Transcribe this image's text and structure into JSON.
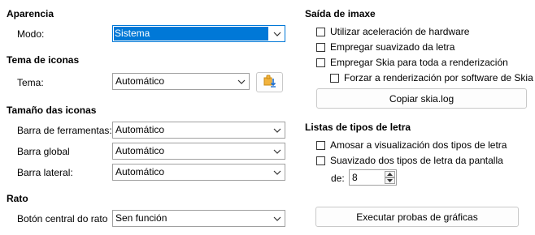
{
  "appearance": {
    "title": "Aparencia",
    "mode_label": "Modo:",
    "mode_value": "Sistema"
  },
  "icon_theme": {
    "title": "Tema de iconas",
    "theme_label": "Tema:",
    "theme_value": "Automático"
  },
  "icon_size": {
    "title": "Tamaño das iconas",
    "toolbar_label": "Barra de ferramentas:",
    "toolbar_value": "Automático",
    "global_label": "Barra global",
    "global_value": "Automático",
    "sidebar_label": "Barra lateral:",
    "sidebar_value": "Automático"
  },
  "mouse": {
    "title": "Rato",
    "middle_label": "Botón central do rato",
    "middle_value": "Sen función"
  },
  "image_output": {
    "title": "Saída de imaxe",
    "hw_accel": "Utilizar aceleración de hardware",
    "antialias": "Empregar suavizado da letra",
    "skia": "Empregar Skia para toda a renderización",
    "skia_sw": "Forzar a renderización por software de Skia",
    "copy_skia_button": "Copiar skia.log"
  },
  "font_lists": {
    "title": "Listas de tipos de letra",
    "preview": "Amosar a visualización dos tipos de letra",
    "screen_aa": "Suavizado dos tipos de letra da pantalla",
    "from_label": "de:",
    "from_value": "8"
  },
  "run_tests_button": "Executar probas de gráficas",
  "icons": {
    "dropdown": "chevron-down-icon",
    "extension": "add-extension-icon",
    "spin_up": "triangle-up-icon",
    "spin_down": "triangle-down-icon"
  }
}
